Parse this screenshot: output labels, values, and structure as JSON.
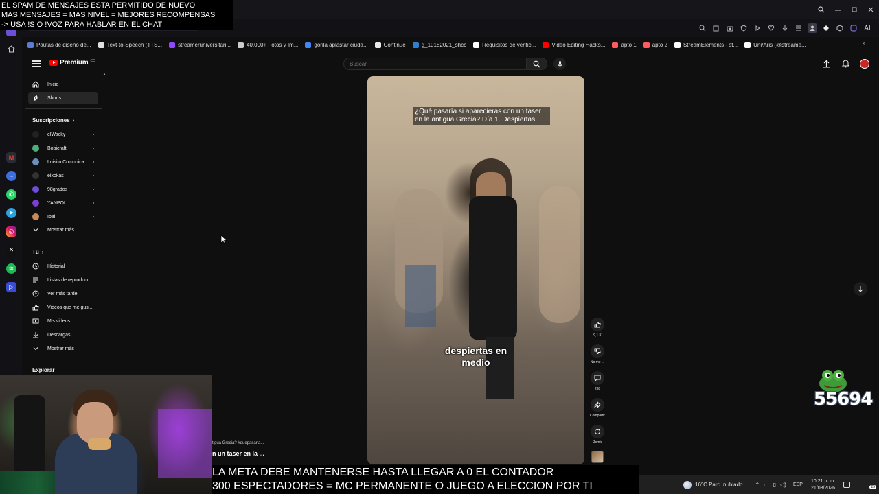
{
  "overlay_top": {
    "line1": "EL SPAM DE MENSAJES ESTA PERMITIDO DE NUEVO",
    "line2": "MAS MENSAJES = MAS NIVEL = MEJORES RECOMPENSAS",
    "line3": "-> USA !S  O !VOZ PARA HABLAR EN EL CHAT"
  },
  "toolbar": {
    "ai_label": "AI"
  },
  "bookmarks": [
    {
      "label": "Pautas de diseño de...",
      "color": "#5b7bd5"
    },
    {
      "label": "Text-to-Speech (TTS...",
      "color": "#e0e0e0"
    },
    {
      "label": "streameruniversitari...",
      "color": "#9146ff"
    },
    {
      "label": "40.000+ Fotos y Im...",
      "color": "#cccccc"
    },
    {
      "label": "gorila aplastar ciuda...",
      "color": "#4285f4"
    },
    {
      "label": "Continue",
      "color": "#e8e8e8"
    },
    {
      "label": "g_10182021_shcc",
      "color": "#2f7fd1"
    },
    {
      "label": "Requisitos de verific...",
      "color": "#ffffff"
    },
    {
      "label": "Video Editing Hacks...",
      "color": "#ff0000"
    },
    {
      "label": "apto 1",
      "color": "#ff5a5f"
    },
    {
      "label": "apto 2",
      "color": "#ff5a5f"
    },
    {
      "label": "StreamElements - st...",
      "color": "#ffffff"
    },
    {
      "label": "Uni/Aris (@streame...",
      "color": "#ffffff"
    }
  ],
  "youtube": {
    "logo_text": "Premium",
    "logo_sup": "CO",
    "search_placeholder": "Buscar"
  },
  "sidebar": {
    "inicio": "Inicio",
    "shorts": "Shorts",
    "subs_header": "Suscripciones",
    "subscriptions": [
      {
        "name": "elWacky",
        "color": "#222222"
      },
      {
        "name": "Bobicraft",
        "color": "#4caf7a"
      },
      {
        "name": "Luisito Comunica",
        "color": "#6a8fbf"
      },
      {
        "name": "elxokas",
        "color": "#333333"
      },
      {
        "name": "98grados",
        "color": "#6d4fd6"
      },
      {
        "name": "YANPOL",
        "color": "#7b3fd0"
      },
      {
        "name": "Ibai",
        "color": "#c98a5a"
      }
    ],
    "show_more_1": "Mostrar más",
    "tu_header": "Tú",
    "tu_items": [
      "Historial",
      "Listas de reproducc...",
      "Ver más tarde",
      "Videos que me gus...",
      "Mis videos",
      "Descargas"
    ],
    "show_more_2": "Mostrar más",
    "explorar": "Explorar"
  },
  "short": {
    "caption_top": "¿Qué pasaría si aparecieras con un taser en la antigua Grecia? Día 1. Despiertas",
    "caption_mid_1": "despiertas en",
    "caption_mid_2": "medio",
    "likes": "9,1 K",
    "dislike_label": "No me ...",
    "comments": "288",
    "share_label": "Compartir",
    "remix_label": "Remix"
  },
  "below_player": {
    "frag1": "tigua Grecia? #quepasaria...",
    "frag2": "n un taser en la ..."
  },
  "overlay_bottom": {
    "line1": "LA META DEBE MANTENERSE HASTA LLEGAR A 0 EL CONTADOR",
    "line2": "300 ESPECTADORES = MC PERMANENTE O JUEGO A ELECCION POR TI"
  },
  "counter": {
    "value": "55694"
  },
  "taskbar": {
    "weather": "16°C  Parc. nublado",
    "lang": "ESP",
    "time": "10:21 p. m.",
    "date": "21/03/2026",
    "badge": "25"
  }
}
